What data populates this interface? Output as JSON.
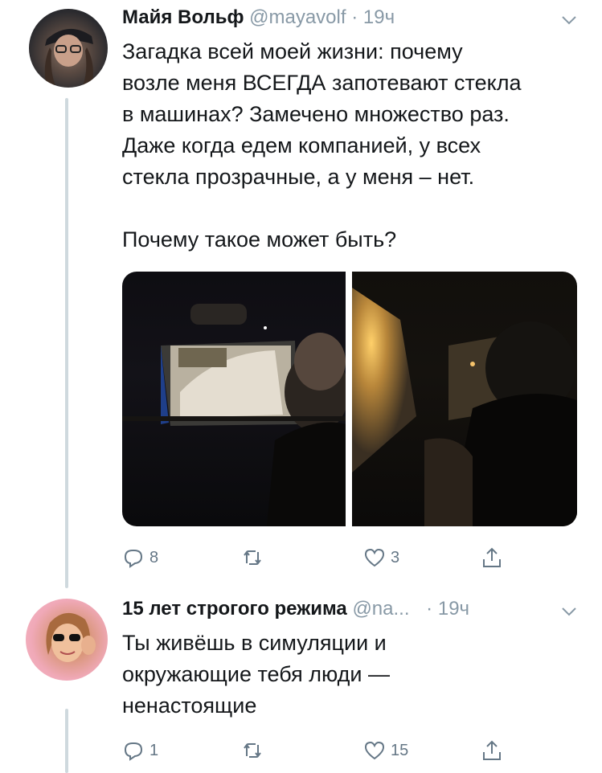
{
  "tweets": [
    {
      "author": {
        "name": "Майя Вольф",
        "handle": "@mayavolf",
        "time": "19ч"
      },
      "text_lines": [
        "Загадка всей моей жизни: почему",
        "возле меня ВСЕГДА запотевают стекла",
        "в машинах? Замечено множество раз.",
        "Даже когда едем компанией, у всех",
        "стекла прозрачные, а у меня – нет.",
        "",
        "Почему такое может быть?"
      ],
      "images": [
        {
          "subject": "car-interior-driver-window"
        },
        {
          "subject": "car-interior-foggy-window"
        }
      ],
      "stats": {
        "replies": "8",
        "retweets": "",
        "likes": "3"
      },
      "icons": {
        "reply": "reply-icon",
        "retweet": "retweet-icon",
        "like": "heart-icon",
        "share": "share-icon",
        "menu": "chevron-down-icon"
      }
    },
    {
      "author": {
        "name": "15 лет строгого режима",
        "handle": "@na...",
        "time": "19ч"
      },
      "text_lines": [
        "Ты живёшь в симуляции и",
        "окружающие тебя люди —",
        "ненастоящие"
      ],
      "stats": {
        "replies": "1",
        "retweets": "",
        "likes": "15"
      },
      "icons": {
        "reply": "reply-icon",
        "retweet": "retweet-icon",
        "like": "heart-icon",
        "share": "share-icon",
        "menu": "chevron-down-icon"
      }
    }
  ],
  "colors": {
    "text": "#14171a",
    "secondary": "#8899a6",
    "thread_line": "#cfd9de",
    "icon": "#657786"
  },
  "separator": "·"
}
